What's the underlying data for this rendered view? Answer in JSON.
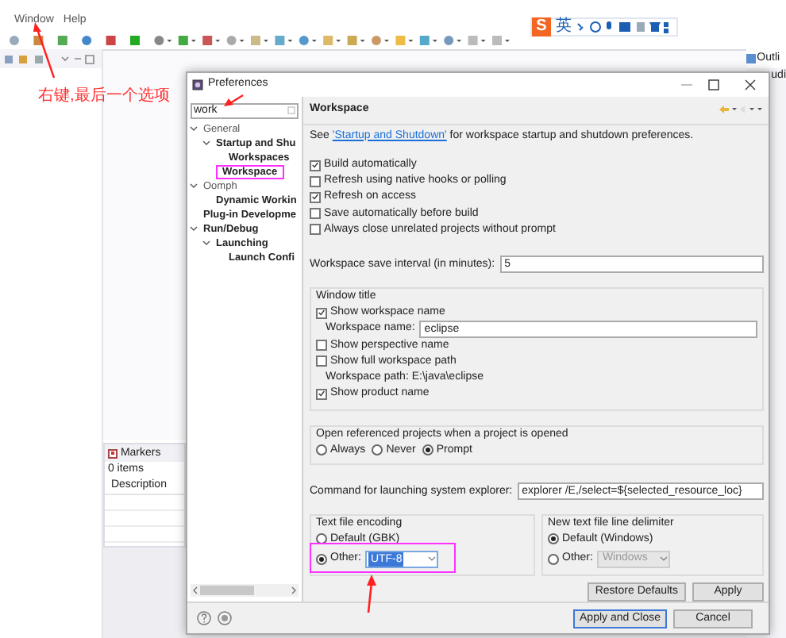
{
  "menu": [
    {
      "label": "Window"
    },
    {
      "label": "Help"
    }
  ],
  "ime_bar": {
    "logo": "S",
    "mode": "英"
  },
  "annotation": {
    "text": "右键,最后一个选项"
  },
  "outline_view": {
    "tab": "Outli",
    "fragment": "udi"
  },
  "markers_view": {
    "tab": "Markers",
    "count": "0 items",
    "column": "Description"
  },
  "dialog": {
    "title": "Preferences",
    "filter": "work",
    "tree": [
      {
        "label": "General",
        "expanded": true,
        "match": false,
        "selected": false,
        "children": [
          {
            "label": "Startup and Shu",
            "expanded": true,
            "match": true,
            "selected": false,
            "children": [
              {
                "label": "Workspaces",
                "match": true,
                "selected": false
              }
            ]
          },
          {
            "label": "Workspace",
            "match": true,
            "selected": true
          }
        ]
      },
      {
        "label": "Oomph",
        "expanded": true,
        "match": false,
        "selected": false,
        "children": [
          {
            "label": "Dynamic Workin",
            "match": true,
            "selected": false
          }
        ]
      },
      {
        "label": "Plug-in Developme",
        "match": true,
        "selected": false
      },
      {
        "label": "Run/Debug",
        "expanded": true,
        "match": true,
        "selected": false,
        "children": [
          {
            "label": "Launching",
            "expanded": true,
            "match": true,
            "selected": false,
            "children": [
              {
                "label": "Launch Confi",
                "match": true,
                "selected": false
              }
            ]
          }
        ]
      }
    ],
    "page": {
      "title": "Workspace",
      "see_prefix": "See ",
      "see_link": "'Startup and Shutdown'",
      "see_suffix": " for workspace startup and shutdown preferences.",
      "options": [
        {
          "label": "Build automatically",
          "checked": true
        },
        {
          "label": "Refresh using native hooks or polling",
          "checked": false
        },
        {
          "label": "Refresh on access",
          "checked": true
        },
        {
          "label": "Save automatically before build",
          "checked": false
        },
        {
          "label": "Always close unrelated projects without prompt",
          "checked": false
        }
      ],
      "save_interval": {
        "label": "Workspace save interval (in minutes):",
        "value": "5"
      },
      "window_title": {
        "title": "Window title",
        "items": [
          {
            "kind": "checkbox",
            "label": "Show workspace name",
            "checked": true
          },
          {
            "kind": "field",
            "label": "Workspace name:",
            "value": "eclipse"
          },
          {
            "kind": "checkbox",
            "label": "Show perspective name",
            "checked": false
          },
          {
            "kind": "checkbox",
            "label": "Show full workspace path",
            "checked": false
          },
          {
            "kind": "text",
            "label": "Workspace path: E:\\java\\eclipse"
          },
          {
            "kind": "checkbox",
            "label": "Show product name",
            "checked": true
          }
        ]
      },
      "open_referenced": {
        "title": "Open referenced projects when a project is opened",
        "choices": [
          {
            "label": "Always",
            "selected": false
          },
          {
            "label": "Never",
            "selected": false
          },
          {
            "label": "Prompt",
            "selected": true
          }
        ]
      },
      "explorer_command": {
        "label": "Command for launching system explorer:",
        "value": "explorer /E,/select=${selected_resource_loc}"
      },
      "encoding": {
        "title": "Text file encoding",
        "choices": [
          {
            "label": "Default (GBK)",
            "selected": false
          },
          {
            "label": "Other:",
            "selected": true,
            "combo": "UTF-8"
          }
        ]
      },
      "delimiter": {
        "title": "New text file line delimiter",
        "choices": [
          {
            "label": "Default (Windows)",
            "selected": true
          },
          {
            "label": "Other:",
            "selected": false,
            "combo": "Windows"
          }
        ]
      },
      "page_buttons": [
        {
          "label": "Restore Defaults"
        },
        {
          "label": "Apply"
        }
      ]
    },
    "buttons": [
      {
        "label": "Apply and Close",
        "default": true
      },
      {
        "label": "Cancel",
        "default": false
      }
    ]
  }
}
